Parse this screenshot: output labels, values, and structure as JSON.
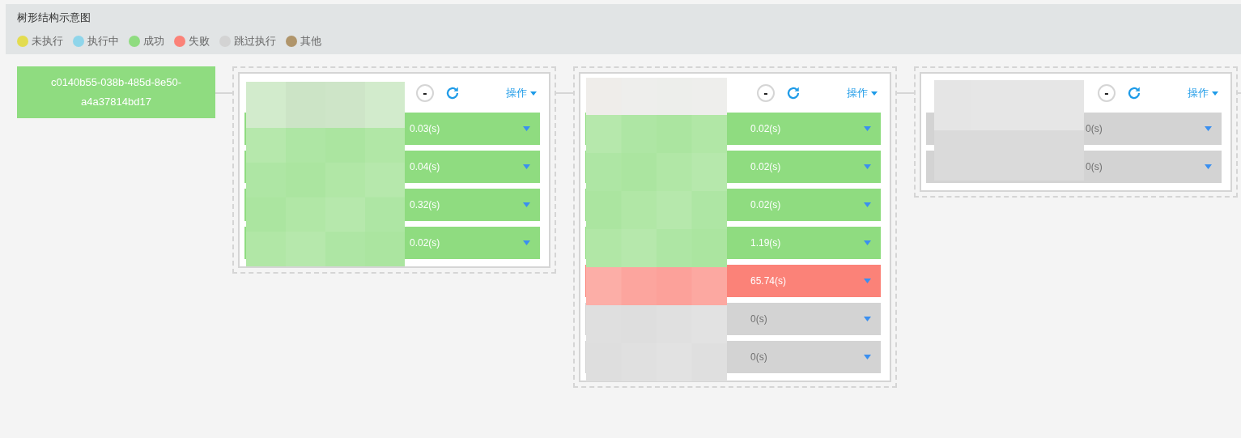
{
  "title": "树形结构示意图",
  "legend": [
    {
      "label": "未执行",
      "color": "#e3dc4f"
    },
    {
      "label": "执行中",
      "color": "#8fd5ea"
    },
    {
      "label": "成功",
      "color": "#8fdc80"
    },
    {
      "label": "失败",
      "color": "#fb8278"
    },
    {
      "label": "跳过执行",
      "color": "#d3d3d3"
    },
    {
      "label": "其他",
      "color": "#b0956b"
    }
  ],
  "root": {
    "label": "c0140b55-038b-485d-8e50-a4a37814bd17",
    "color": "#8fdc80"
  },
  "groups": [
    {
      "masked": true,
      "collapse_symbol": "-",
      "action_label": "操作",
      "rows": [
        {
          "duration": "0.03(s)",
          "color": "#8fdc80"
        },
        {
          "duration": "0.04(s)",
          "color": "#8fdc80"
        },
        {
          "duration": "0.32(s)",
          "color": "#8fdc80"
        },
        {
          "duration": "0.02(s)",
          "color": "#8fdc80"
        }
      ]
    },
    {
      "masked": true,
      "collapse_symbol": "-",
      "action_label": "操作",
      "rows": [
        {
          "duration": "0.02(s)",
          "color": "#8fdc80"
        },
        {
          "duration": "0.02(s)",
          "color": "#8fdc80"
        },
        {
          "duration": "0.02(s)",
          "color": "#8fdc80"
        },
        {
          "duration": "1.19(s)",
          "color": "#8fdc80"
        },
        {
          "duration": "65.74(s)",
          "color": "#fb8278"
        },
        {
          "duration": "0(s)",
          "color": "#d3d3d3"
        },
        {
          "duration": "0(s)",
          "color": "#d3d3d3"
        }
      ]
    },
    {
      "masked": true,
      "collapse_symbol": "-",
      "action_label": "操作",
      "rows": [
        {
          "duration": "0(s)",
          "color": "#d3d3d3"
        },
        {
          "duration": "0(s)",
          "color": "#d3d3d3"
        }
      ]
    }
  ]
}
